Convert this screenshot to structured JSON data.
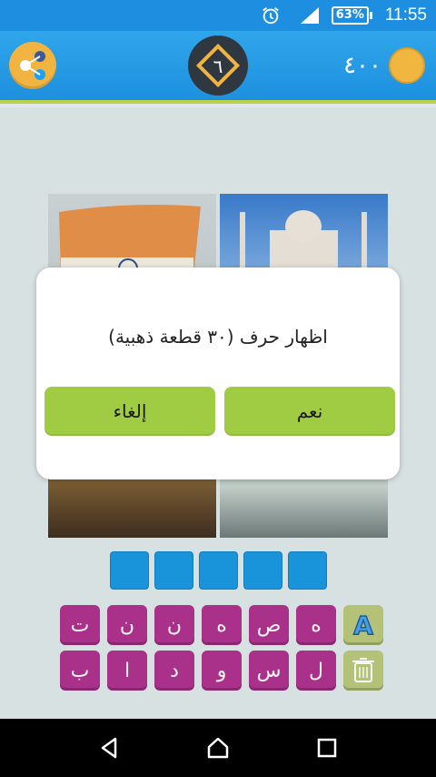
{
  "status_bar": {
    "battery": "63%",
    "time": "11:55",
    "icons": [
      "alarm-icon",
      "signal-icon",
      "battery-icon"
    ]
  },
  "header": {
    "level": "٦",
    "coins": "٤٠٠",
    "share_icon": "share-icon",
    "coin_icon": "coin-icon"
  },
  "dialog": {
    "message": "اظهار حرف (٣٠ قطعة ذهبية)",
    "yes_label": "نعم",
    "cancel_label": "إلغاء"
  },
  "answer_slots": 5,
  "keyboard": {
    "row1": [
      "ت",
      "ن",
      "ن",
      "ه",
      "ص",
      "ه"
    ],
    "row2": [
      "ب",
      "ا",
      "د",
      "و",
      "س",
      "ل"
    ],
    "helper_icons": [
      "hint-letter-icon",
      "delete-icon"
    ]
  },
  "nav": [
    "back-icon",
    "home-icon",
    "recents-icon"
  ],
  "colors": {
    "status_bar": "#1e8fe0",
    "header": "#2fa6ea",
    "accent_green": "#a0cc44",
    "key_purple": "#b0338f",
    "slot_blue": "#1a98e2"
  }
}
